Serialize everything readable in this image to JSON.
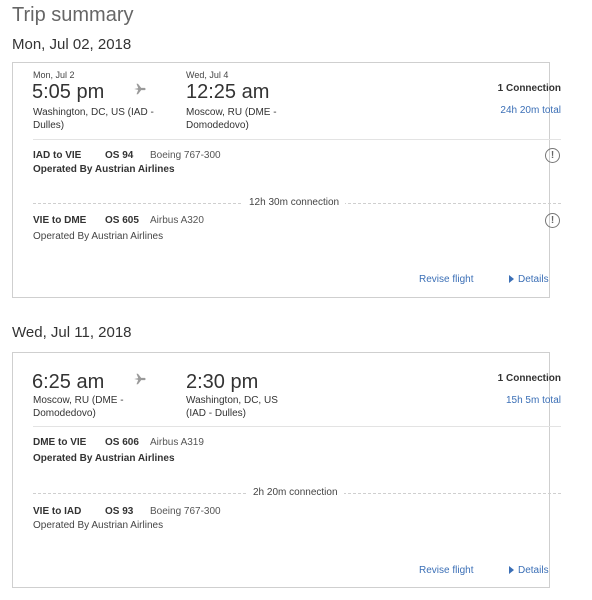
{
  "page": {
    "title": "Trip summary"
  },
  "trips": [
    {
      "date": "Mon, Jul 02, 2018",
      "depart_date": "Mon, Jul 2",
      "depart_time": "5:05 pm",
      "depart_place_1": "Washington, DC, US (IAD -",
      "depart_place_2": "Dulles)",
      "arrive_date": "Wed, Jul 4",
      "arrive_time": "12:25 am",
      "arrive_place_1": "Moscow, RU (DME -",
      "arrive_place_2": "Domodedovo)",
      "connections": "1 Connection",
      "total": "24h 20m total",
      "segments": [
        {
          "route": "IAD to VIE",
          "flight": "OS 94",
          "aircraft": "Boeing 767-300",
          "operated": "Operated By Austrian Airlines"
        },
        {
          "route": "VIE to DME",
          "flight": "OS 605",
          "aircraft": "Airbus A320",
          "operated": "Operated By Austrian Airlines"
        }
      ],
      "connection_time": "12h 30m connection",
      "revise": "Revise flight",
      "details": "Details"
    },
    {
      "date": "Wed, Jul 11, 2018",
      "depart_time": "6:25 am",
      "depart_place_1": "Moscow, RU (DME -",
      "depart_place_2": "Domodedovo)",
      "arrive_time": "2:30 pm",
      "arrive_place_1": "Washington, DC, US",
      "arrive_place_2": "(IAD - Dulles)",
      "connections": "1 Connection",
      "total": "15h 5m total",
      "segments": [
        {
          "route": "DME to VIE",
          "flight": "OS 606",
          "aircraft": "Airbus A319",
          "operated": "Operated By Austrian Airlines"
        },
        {
          "route": "VIE to IAD",
          "flight": "OS 93",
          "aircraft": "Boeing 767-300",
          "operated": "Operated By Austrian Airlines"
        }
      ],
      "connection_time": "2h 20m connection",
      "revise": "Revise flight",
      "details": "Details"
    }
  ],
  "icons": {
    "plane": "airplane-icon",
    "warning": "info-alert-icon",
    "details": "triangle-right-icon"
  },
  "colors": {
    "link": "#3b6fb6",
    "border": "#cfcfcf"
  }
}
